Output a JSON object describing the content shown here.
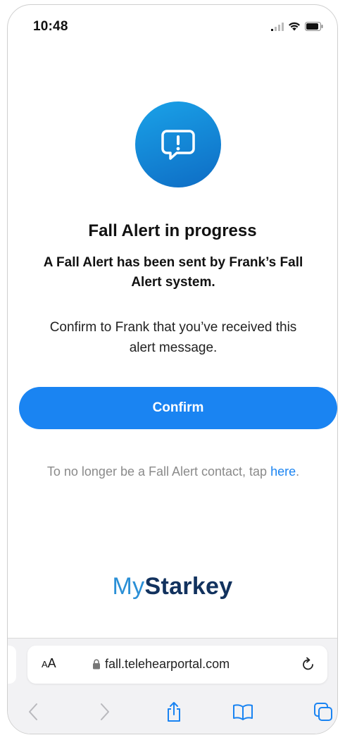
{
  "status_bar": {
    "time": "10:48"
  },
  "alert": {
    "icon": "exclamation-speech-bubble-icon",
    "title": "Fall Alert in progress",
    "subtitle": "A Fall Alert has been sent by Frank’s Fall Alert system.",
    "instruction": "Confirm to Frank that you’ve received this alert message."
  },
  "confirm_label": "Confirm",
  "unsubscribe": {
    "text_before": "To no longer be a Fall Alert contact, tap ",
    "link_label": "here",
    "text_after": "."
  },
  "brand": {
    "my": "My",
    "starkey": "Starkey"
  },
  "browser": {
    "aa_large": "A",
    "aa_small": "A",
    "url": "fall.telehearportal.com"
  },
  "colors": {
    "accent": "#1a84f2",
    "brand_light": "#2a8fd6",
    "brand_dark": "#12325e"
  }
}
